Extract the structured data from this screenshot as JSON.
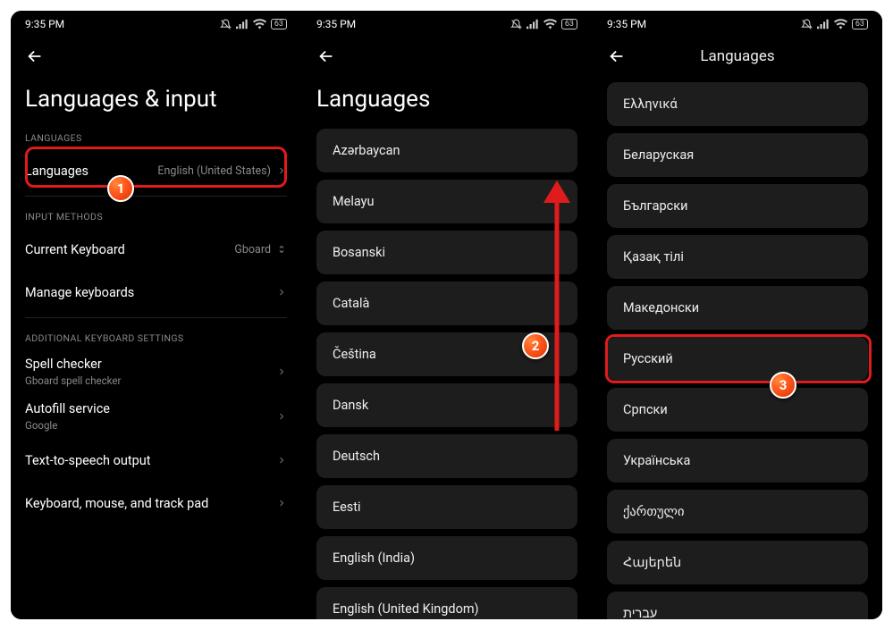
{
  "status": {
    "time": "9:35 PM",
    "battery": "63"
  },
  "screen1": {
    "title": "Languages & input",
    "sections": {
      "languages": {
        "label": "LANGUAGES",
        "itemLabel": "Languages",
        "value": "English (United States)"
      },
      "inputMethods": {
        "label": "INPUT METHODS",
        "currentKeyboardLabel": "Current Keyboard",
        "currentKeyboardValue": "Gboard",
        "manageLabel": "Manage keyboards"
      },
      "additional": {
        "label": "ADDITIONAL KEYBOARD SETTINGS",
        "spellLabel": "Spell checker",
        "spellSub": "Gboard spell checker",
        "autofillLabel": "Autofill service",
        "autofillSub": "Google",
        "ttsLabel": "Text-to-speech output",
        "kbmLabel": "Keyboard, mouse, and track pad"
      }
    },
    "step": "1"
  },
  "screen2": {
    "title": "Languages",
    "items": [
      "Azərbaycan",
      "Melayu",
      "Bosanski",
      "Català",
      "Čeština",
      "Dansk",
      "Deutsch",
      "Eesti",
      "English (India)",
      "English (United Kingdom)"
    ],
    "step": "2"
  },
  "screen3": {
    "headerTitle": "Languages",
    "items": [
      "Ελληνικά",
      "Беларуская",
      "Български",
      "Қазақ тілі",
      "Македонски",
      "Русский",
      "Српски",
      "Українська",
      "ქართული",
      "Հայերեն",
      "עברית"
    ],
    "highlightIndex": 5,
    "step": "3"
  }
}
